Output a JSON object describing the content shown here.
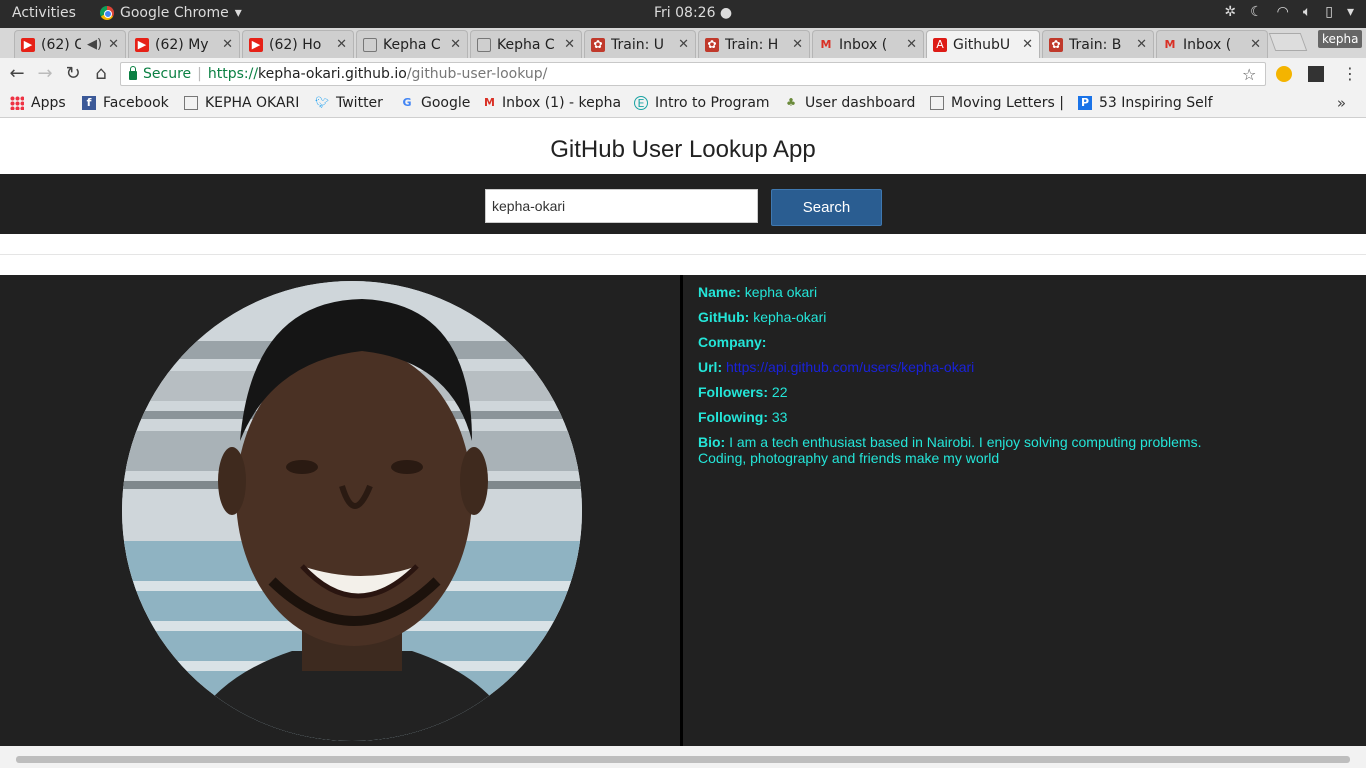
{
  "system_bar": {
    "activities": "Activities",
    "app_name": "Google Chrome",
    "clock": "Fri 08:26"
  },
  "tabs": [
    {
      "title": "(62) C",
      "icon": "youtube-icon"
    },
    {
      "title": "(62) My",
      "icon": "youtube-icon"
    },
    {
      "title": "(62) Ho",
      "icon": "youtube-icon"
    },
    {
      "title": "Kepha C",
      "icon": "page-icon"
    },
    {
      "title": "Kepha C",
      "icon": "page-icon"
    },
    {
      "title": "Train: U",
      "icon": "codewars-icon"
    },
    {
      "title": "Train: H",
      "icon": "codewars-icon"
    },
    {
      "title": "Inbox (",
      "icon": "gmail-icon"
    },
    {
      "title": "GithubU",
      "icon": "angular-icon",
      "active": true
    },
    {
      "title": "Train: B",
      "icon": "codewars-icon"
    },
    {
      "title": "Inbox (",
      "icon": "gmail-icon"
    }
  ],
  "profile": "kepha",
  "omnibox": {
    "secure_label": "Secure",
    "scheme": "https://",
    "host": "kepha-okari.github.io",
    "path": "/github-user-lookup/"
  },
  "bookmarks": [
    {
      "label": "Apps",
      "icon": "apps-grid-icon"
    },
    {
      "label": "Facebook",
      "icon": "facebook-icon"
    },
    {
      "label": "KEPHA OKARI",
      "icon": "page-icon"
    },
    {
      "label": "Twitter",
      "icon": "twitter-icon"
    },
    {
      "label": "Google",
      "icon": "google-icon"
    },
    {
      "label": "Inbox (1) - kepha",
      "icon": "gmail-icon"
    },
    {
      "label": "Intro to Program",
      "icon": "e-icon"
    },
    {
      "label": "User dashboard",
      "icon": "tree-icon"
    },
    {
      "label": "Moving Letters |",
      "icon": "page-icon"
    },
    {
      "label": "53 Inspiring Self",
      "icon": "p-icon"
    }
  ],
  "app": {
    "title": "GitHub User Lookup App",
    "search_value": "kepha-okari",
    "search_button": "Search"
  },
  "profile_info": {
    "name_label": "Name:",
    "name": "kepha okari",
    "github_label": "GitHub:",
    "github": "kepha-okari",
    "company_label": "Company:",
    "company": "",
    "url_label": "Url:",
    "url": "https://api.github.com/users/kepha-okari",
    "followers_label": "Followers:",
    "followers": "22",
    "following_label": "Following:",
    "following": "33",
    "bio_label": "Bio:",
    "bio": "I am a tech enthusiast based in Nairobi. I enjoy solving computing problems. Coding, photography and friends make my world"
  }
}
